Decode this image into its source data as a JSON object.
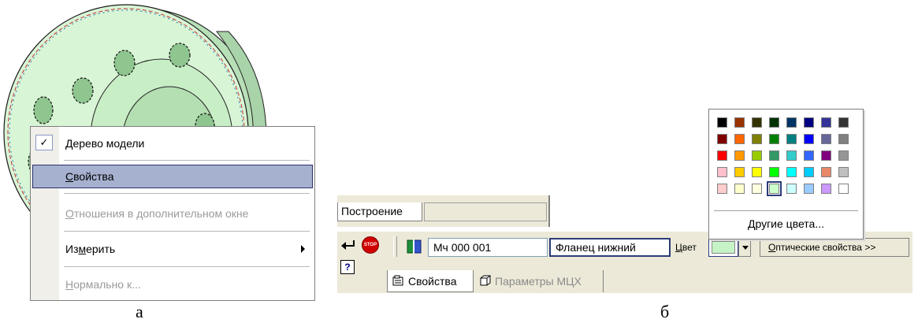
{
  "context_menu": {
    "items": [
      {
        "label": "Дерево модели",
        "accel": "Д",
        "rest": "ерево модели",
        "checked": true,
        "state": "normal"
      },
      {
        "label": "Свойства",
        "accel": "С",
        "rest": "войства",
        "state": "selected"
      },
      {
        "label": "Отношения в дополнительном окне",
        "accel": "О",
        "rest": "тношения в дополнительном окне",
        "state": "disabled"
      },
      {
        "label": "Измерить",
        "accel_prefix": "Из",
        "accel": "м",
        "rest": "ерить",
        "state": "normal",
        "submenu": true
      },
      {
        "label": "Нормально к...",
        "accel": "Н",
        "rest": "ормально к...",
        "state": "disabled"
      }
    ],
    "check_mark": "✓"
  },
  "captions": {
    "a": "а",
    "b": "б"
  },
  "toolbar": {
    "tab_top": "Построение",
    "stop_text": "STOP",
    "help_text": "?",
    "designation": "Мч 000 001",
    "name": "Фланец нижний",
    "color_label_accel": "Ц",
    "color_label_rest": "вет",
    "optical_accel": "О",
    "optical_rest": "птические свойства",
    "optical_suffix": ">>",
    "selected_color": "#c6f3c6",
    "tabs": [
      {
        "label": "Свойства",
        "active": true
      },
      {
        "label": "Параметры МЦХ",
        "active": false
      }
    ]
  },
  "palette": {
    "other_colors": "Другие цвета...",
    "rows": [
      [
        "#000000",
        "#993300",
        "#333300",
        "#003300",
        "#003366",
        "#000080",
        "#333399",
        "#333333"
      ],
      [
        "#800000",
        "#ff6600",
        "#808000",
        "#008000",
        "#008080",
        "#0000ff",
        "#666699",
        "#808080"
      ],
      [
        "#ff0000",
        "#ff9900",
        "#99cc00",
        "#339966",
        "#33cccc",
        "#3366ff",
        "#800080",
        "#969696"
      ],
      [
        "#ff00ff",
        "#ffcc00",
        "#ffff00",
        "#00ff00",
        "#00ffff",
        "#00ccff",
        "#993366",
        "#c0c0c0"
      ],
      [
        "#ffcccc",
        "#ffffcc",
        "#ffffe0",
        "#ccffcc",
        "#ccffff",
        "#99ccff",
        "#cc99ff",
        "#ffffff"
      ]
    ],
    "row3_override": [
      "#ffc0cb",
      "#ffcc00",
      "#ffff00",
      "#00ff00",
      "#00ffff",
      "#00ccff",
      "#e8876a",
      "#c0c0c0"
    ],
    "selected_row": 4,
    "selected_col": 3
  }
}
